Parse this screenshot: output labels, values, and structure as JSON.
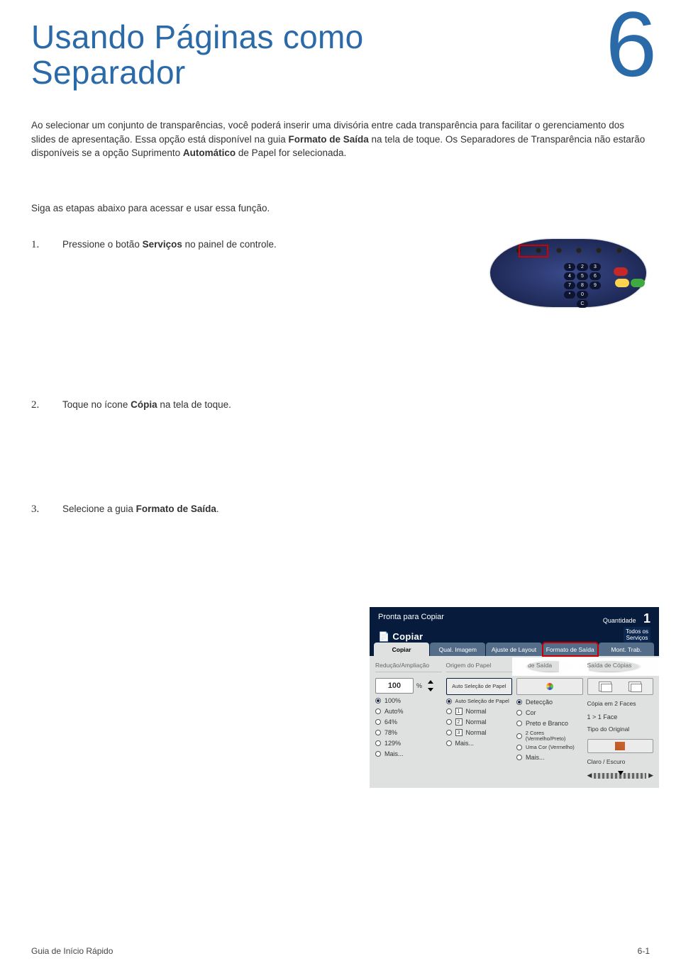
{
  "title_line1": "Usando Páginas como",
  "title_line2": "Separador",
  "chapter_number": "6",
  "intro_p1_a": "Ao selecionar um conjunto de transparências, você poderá inserir uma divisória entre cada transparência para facilitar o gerenciamento dos slides de apresentação. Essa opção está disponível na guia ",
  "intro_p1_b": "Formato de Saída",
  "intro_p1_c": " na tela de toque. Os Separadores de Transparência não estarão disponíveis se a opção Suprimento ",
  "intro_p1_d": "Automático",
  "intro_p1_e": " de Papel for selecionada.",
  "follow_steps": "Siga as etapas abaixo para acessar e usar essa função.",
  "steps": {
    "s1": {
      "num": "1.",
      "a": "Pressione o botão ",
      "b": "Serviços",
      "c": " no painel de controle."
    },
    "s2": {
      "num": "2.",
      "a": "Toque no ícone ",
      "b": "Cópia",
      "c": " na tela de toque."
    },
    "s3": {
      "num": "3.",
      "a": "Selecione a guia ",
      "b": "Formato de Saída",
      "c": "."
    }
  },
  "keypad": [
    "1",
    "2",
    "3",
    "4",
    "5",
    "6",
    "7",
    "8",
    "9",
    "*",
    "0",
    "",
    "",
    "C",
    ""
  ],
  "ui": {
    "ready": "Pronta para Copiar",
    "qty_label": "Quantidade",
    "qty_value": "1",
    "fn_title": "Copiar",
    "fn_all": "Todos os Serviços",
    "tabs": [
      "Copiar",
      "Qual. Imagem",
      "Ajuste de Layout",
      "Formato de Saída",
      "Mont. Trab."
    ],
    "col1": {
      "title": "Redução/Ampliação",
      "value": "100",
      "pct": "%",
      "opts": [
        "100%",
        "Auto%",
        "64%",
        "78%",
        "129%",
        "Mais..."
      ]
    },
    "col2": {
      "title": "Origem do Papel",
      "auto_btn": "Auto Seleção de Papel",
      "opts": [
        "Auto Seleção de Papel",
        "Normal",
        "Normal",
        "Normal",
        "Mais..."
      ],
      "nums": [
        "",
        "1",
        "2",
        "3",
        ""
      ]
    },
    "col3": {
      "title": "Cor de Saída",
      "opts": [
        "Detecção",
        "Cor",
        "Preto e Branco",
        "2 Cores (Vermelho/Preto)",
        "Uma Cor (Vermelho)",
        "Mais..."
      ]
    },
    "col4": {
      "title": "Saída de Cópias",
      "twoface_title": "Cópia em 2 Faces",
      "twoface_opt": "1 > 1 Face",
      "orig_title": "Tipo do Original",
      "dark_title": "Claro / Escuro"
    }
  },
  "footer_left": "Guia de Início Rápido",
  "footer_right": "6-1"
}
